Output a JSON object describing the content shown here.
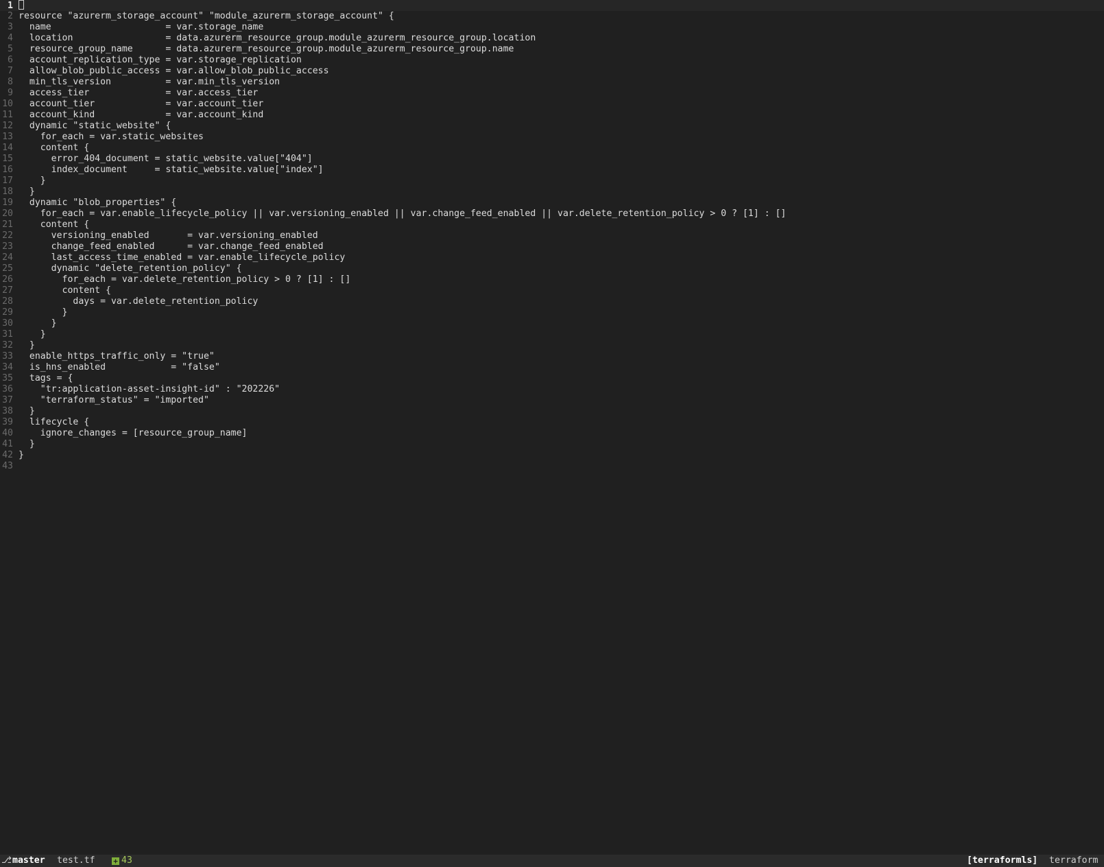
{
  "editor": {
    "cursor_line": 1,
    "lines": [
      {
        "n": "1",
        "text": ""
      },
      {
        "n": "2",
        "text": "resource \"azurerm_storage_account\" \"module_azurerm_storage_account\" {"
      },
      {
        "n": "3",
        "text": "  name                     = var.storage_name"
      },
      {
        "n": "4",
        "text": "  location                 = data.azurerm_resource_group.module_azurerm_resource_group.location"
      },
      {
        "n": "5",
        "text": "  resource_group_name      = data.azurerm_resource_group.module_azurerm_resource_group.name"
      },
      {
        "n": "6",
        "text": "  account_replication_type = var.storage_replication"
      },
      {
        "n": "7",
        "text": "  allow_blob_public_access = var.allow_blob_public_access"
      },
      {
        "n": "8",
        "text": "  min_tls_version          = var.min_tls_version"
      },
      {
        "n": "9",
        "text": "  access_tier              = var.access_tier"
      },
      {
        "n": "10",
        "text": "  account_tier             = var.account_tier"
      },
      {
        "n": "11",
        "text": "  account_kind             = var.account_kind"
      },
      {
        "n": "12",
        "text": "  dynamic \"static_website\" {"
      },
      {
        "n": "13",
        "text": "    for_each = var.static_websites"
      },
      {
        "n": "14",
        "text": "    content {"
      },
      {
        "n": "15",
        "text": "      error_404_document = static_website.value[\"404\"]"
      },
      {
        "n": "16",
        "text": "      index_document     = static_website.value[\"index\"]"
      },
      {
        "n": "17",
        "text": "    }"
      },
      {
        "n": "18",
        "text": "  }"
      },
      {
        "n": "19",
        "text": "  dynamic \"blob_properties\" {"
      },
      {
        "n": "20",
        "text": "    for_each = var.enable_lifecycle_policy || var.versioning_enabled || var.change_feed_enabled || var.delete_retention_policy > 0 ? [1] : []"
      },
      {
        "n": "21",
        "text": "    content {"
      },
      {
        "n": "22",
        "text": "      versioning_enabled       = var.versioning_enabled"
      },
      {
        "n": "23",
        "text": "      change_feed_enabled      = var.change_feed_enabled"
      },
      {
        "n": "24",
        "text": "      last_access_time_enabled = var.enable_lifecycle_policy"
      },
      {
        "n": "25",
        "text": "      dynamic \"delete_retention_policy\" {"
      },
      {
        "n": "26",
        "text": "        for_each = var.delete_retention_policy > 0 ? [1] : []"
      },
      {
        "n": "27",
        "text": "        content {"
      },
      {
        "n": "28",
        "text": "          days = var.delete_retention_policy"
      },
      {
        "n": "29",
        "text": "        }"
      },
      {
        "n": "30",
        "text": "      }"
      },
      {
        "n": "31",
        "text": "    }"
      },
      {
        "n": "32",
        "text": "  }"
      },
      {
        "n": "33",
        "text": "  enable_https_traffic_only = \"true\""
      },
      {
        "n": "34",
        "text": "  is_hns_enabled            = \"false\""
      },
      {
        "n": "35",
        "text": "  tags = {"
      },
      {
        "n": "36",
        "text": "    \"tr:application-asset-insight-id\" : \"202226\""
      },
      {
        "n": "37",
        "text": "    \"terraform_status\" = \"imported\""
      },
      {
        "n": "38",
        "text": "  }"
      },
      {
        "n": "39",
        "text": "  lifecycle {"
      },
      {
        "n": "40",
        "text": "    ignore_changes = [resource_group_name]"
      },
      {
        "n": "41",
        "text": "  }"
      },
      {
        "n": "42",
        "text": "}"
      },
      {
        "n": "43",
        "text": ""
      }
    ]
  },
  "statusbar": {
    "branch_icon": "git-branch-icon",
    "branch": "master",
    "filename": "test.tf",
    "added_icon": "diff-added-icon",
    "added_count": "43",
    "lsp": "[terraformls]",
    "filetype": "terraform"
  },
  "colors": {
    "background": "#202020",
    "text": "#dcdcdc",
    "line_number": "#6a6a6a",
    "statusbar_bg": "#2b2b2b",
    "added": "#a6c85b"
  }
}
